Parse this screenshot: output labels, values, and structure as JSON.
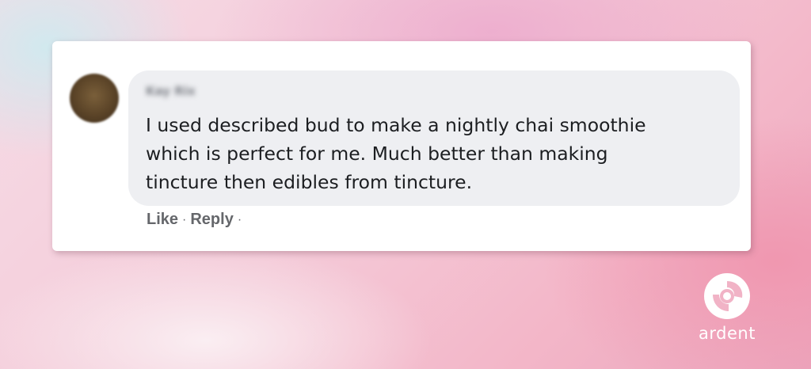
{
  "comment": {
    "author_name": "Kay Rix",
    "text_lines": [
      "I used described bud to make a nightly chai smoothie",
      "which is perfect for me. Much better than making",
      "tincture then edibles from tincture."
    ],
    "actions": {
      "like_label": "Like",
      "separator": "·",
      "reply_label": "Reply"
    }
  },
  "branding": {
    "logo_icon": "ardent-swirl-icon",
    "name": "ardent"
  },
  "colors": {
    "card_background": "#ffffff",
    "bubble_background": "#eeeff2",
    "comment_text": "#1c1e21",
    "action_text": "#65676b",
    "logo": "#ffffff"
  }
}
